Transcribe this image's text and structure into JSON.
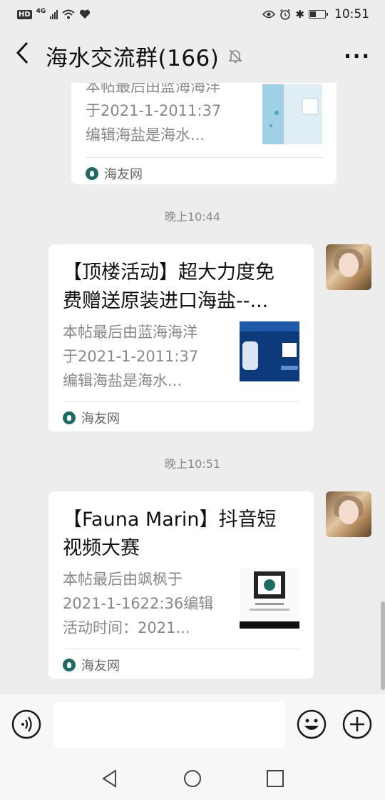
{
  "status_bar": {
    "hd": "HD",
    "network": "4G",
    "time": "10:51"
  },
  "header": {
    "title": "海水交流群(166)",
    "back_icon": "chevron-left-icon",
    "muted_icon": "bell-off-icon",
    "more_icon": "more-horizontal-icon"
  },
  "messages": [
    {
      "title": "",
      "desc": "本帖最后由蓝海海洋于2021-1-2011:37编辑海盐是海水...",
      "desc_lines": [
        "本帖最后由蓝海海洋",
        "于2021-1-2011:37",
        "编辑海盐是海水..."
      ],
      "source": "海友网",
      "partial": true
    },
    {
      "time": "晚上10:44",
      "title": "【顶楼活动】超大力度免费赠送原装进口海盐--...",
      "title_lines": [
        "【顶楼活动】超大力度免",
        "费赠送原装进口海盐--..."
      ],
      "desc_lines": [
        "本帖最后由蓝海海洋",
        "于2021-1-2011:37",
        "编辑海盐是海水..."
      ],
      "source": "海友网"
    },
    {
      "time": "晚上10:51",
      "title_lines": [
        "【Fauna Marin】抖音短",
        "视频大赛"
      ],
      "desc_lines": [
        "本帖最后由飒枫于",
        "2021-1-1622:36编辑",
        "活动时间：2021..."
      ],
      "source": "海友网"
    }
  ],
  "input_bar": {
    "voice_icon": "voice-icon",
    "emoji_icon": "emoji-icon",
    "plus_icon": "plus-circle-icon",
    "placeholder": ""
  },
  "nav": {
    "back_icon": "nav-back-icon",
    "home_icon": "nav-home-icon",
    "recents_icon": "nav-recents-icon"
  },
  "colors": {
    "background": "#ededed",
    "card": "#ffffff",
    "meta_text": "#888888",
    "source_logo": "#1e6b63"
  }
}
